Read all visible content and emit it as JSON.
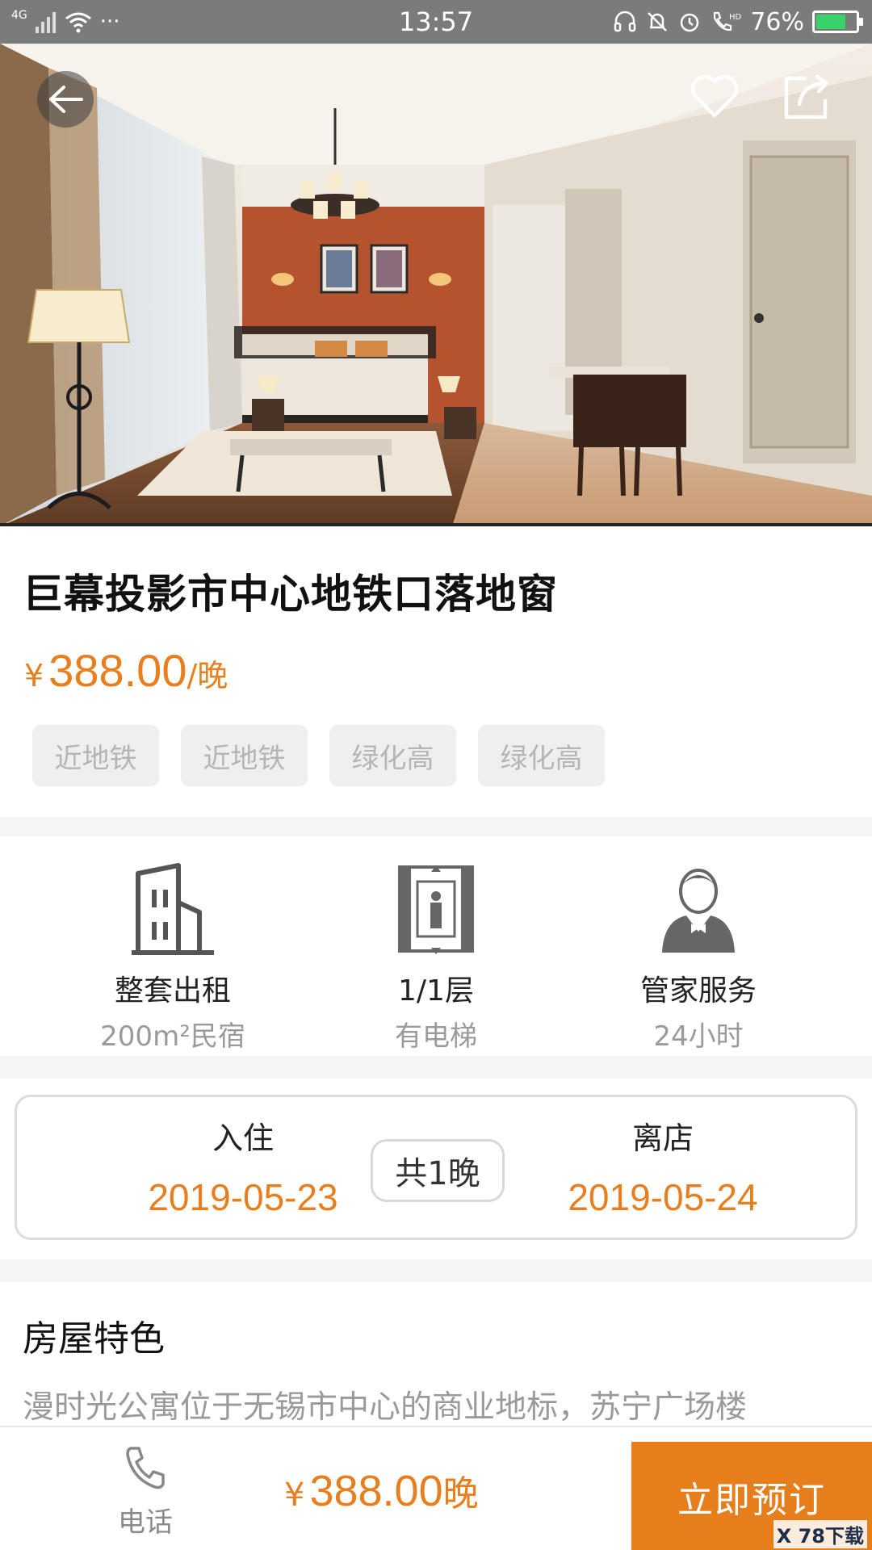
{
  "status_bar": {
    "network": "4G",
    "dots": "···",
    "time": "13:57",
    "hd": "HD",
    "battery_percent": "76%",
    "battery_level": 0.76
  },
  "hero": {
    "back_icon": "back-arrow-icon",
    "favorite_icon": "heart-icon",
    "share_icon": "share-icon"
  },
  "listing": {
    "title": "巨幕投影市中心地铁口落地窗",
    "price_symbol": "¥",
    "price": "388.00",
    "price_unit": "/晚",
    "tags": [
      "近地铁",
      "近地铁",
      "绿化高",
      "绿化高"
    ]
  },
  "features": [
    {
      "icon": "building-icon",
      "main": "整套出租",
      "sub": "200m²民宿"
    },
    {
      "icon": "elevator-icon",
      "main": "1/1层",
      "sub": "有电梯"
    },
    {
      "icon": "butler-icon",
      "main": "管家服务",
      "sub": "24小时"
    }
  ],
  "dates": {
    "checkin_label": "入住",
    "checkin_date": "2019-05-23",
    "nights": "共1晚",
    "checkout_label": "离店",
    "checkout_date": "2019-05-24"
  },
  "description": {
    "title": "房屋特色",
    "text": "漫时光公寓位于无锡市中心的商业地标，苏宁广场楼"
  },
  "bottom_bar": {
    "phone_label": "电话",
    "price_symbol": "¥",
    "price": "388.00",
    "price_unit": "晚",
    "book_label": "立即预订",
    "watermark": "X 78下载"
  },
  "colors": {
    "accent": "#e87e1e",
    "book_button": "#e67e1c",
    "status_bar": "#7b7b7b"
  }
}
